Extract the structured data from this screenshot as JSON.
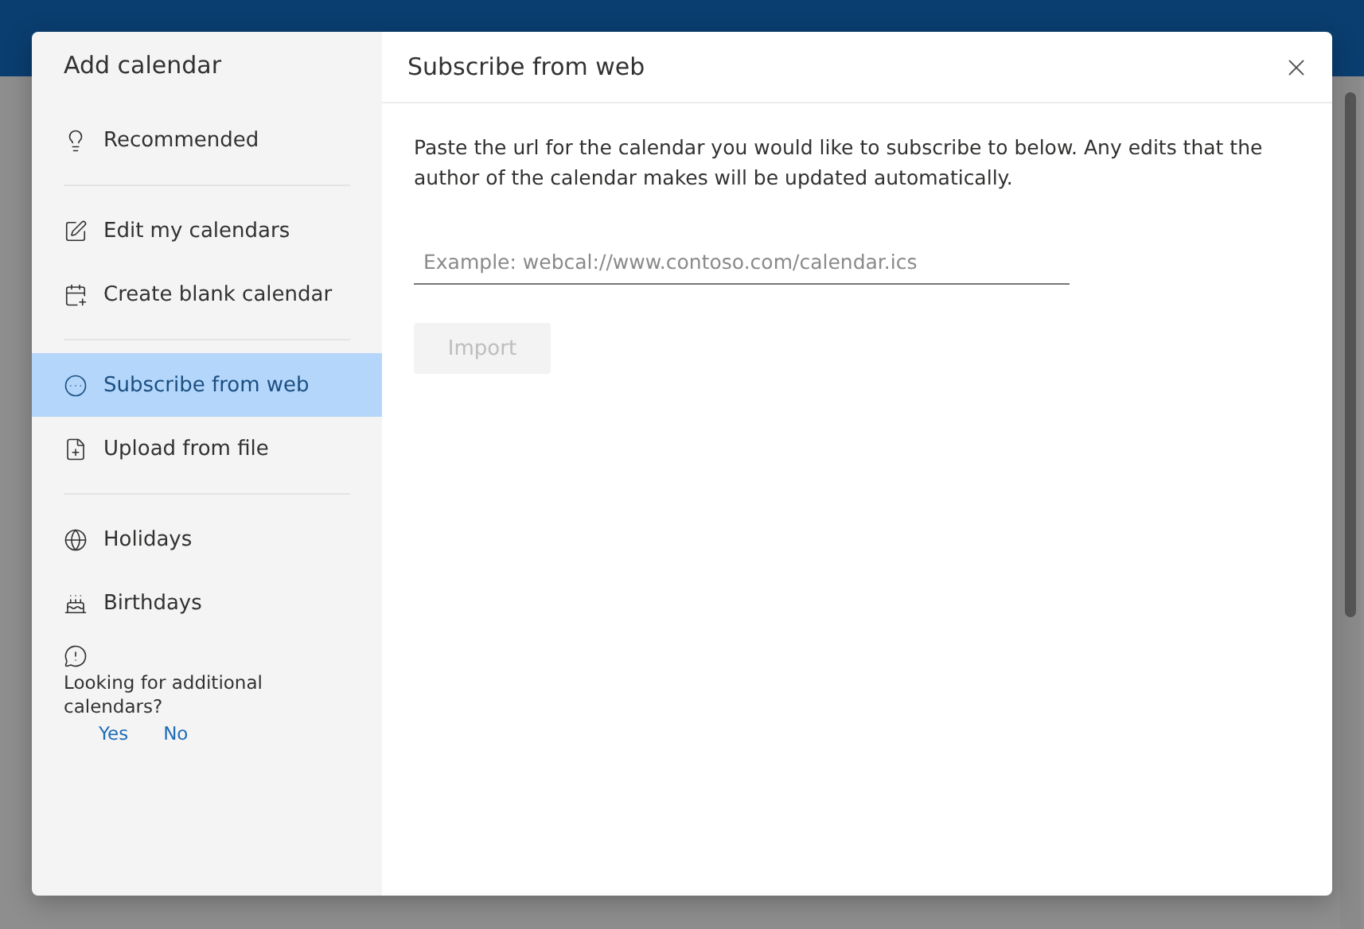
{
  "sidebar": {
    "title": "Add calendar",
    "groups": [
      [
        {
          "label": "Recommended",
          "selected": false
        }
      ],
      [
        {
          "label": "Edit my calendars",
          "selected": false
        },
        {
          "label": "Create blank calendar",
          "selected": false
        }
      ],
      [
        {
          "label": "Subscribe from web",
          "selected": true
        },
        {
          "label": "Upload from file",
          "selected": false
        }
      ],
      [
        {
          "label": "Holidays",
          "selected": false
        },
        {
          "label": "Birthdays",
          "selected": false
        }
      ]
    ],
    "feedback": {
      "question": "Looking for additional calendars?",
      "answers": [
        "Yes",
        "No"
      ]
    }
  },
  "panel": {
    "title": "Subscribe from web",
    "description": "Paste the url for the calendar you would like to subscribe to below. Any edits that the author of the calendar makes will be updated automatically.",
    "url_field": {
      "placeholder": "Example: webcal://www.contoso.com/calendar.ics"
    },
    "import_button": {
      "label": "Import",
      "disabled": true
    }
  }
}
